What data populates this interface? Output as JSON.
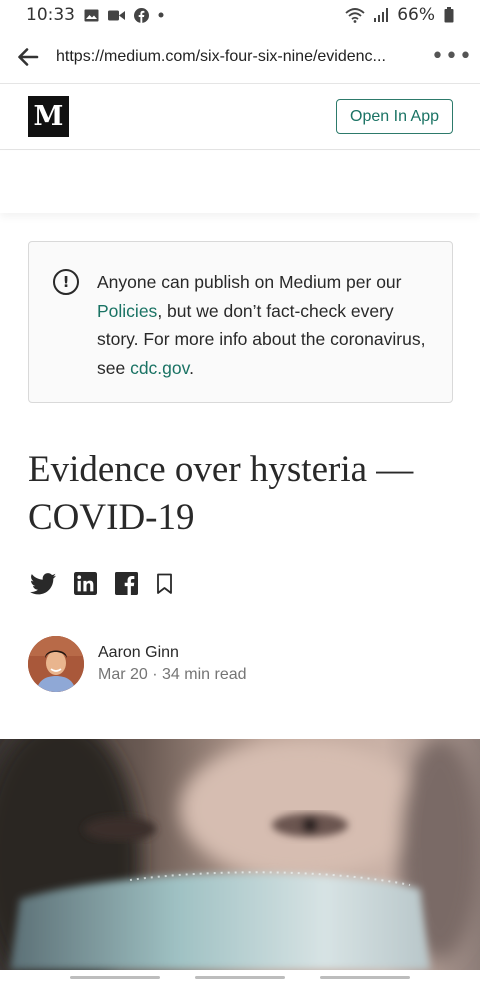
{
  "status_bar": {
    "time": "10:33",
    "battery_percent": "66%",
    "left_icons": [
      "gallery-icon",
      "video-call-icon",
      "facebook-notification-icon",
      "dot-icon"
    ],
    "right_icons": [
      "wifi-icon",
      "signal-icon",
      "battery-icon"
    ]
  },
  "browser": {
    "url": "https://medium.com/six-four-six-nine/evidenc...",
    "menu_glyph": "•••"
  },
  "header": {
    "logo_letter": "M",
    "open_app_label": "Open In App",
    "accent_color": "#1a7364"
  },
  "notice": {
    "icon_glyph": "!",
    "text_1": "Anyone can publish on Medium per our ",
    "link_policies": "Policies",
    "text_2": ", but we don’t fact-check every story. For more info about the coronavirus, see ",
    "link_cdc": "cdc.gov",
    "text_3": "."
  },
  "article": {
    "title": "Evidence over hysteria — COVID-19",
    "share_icons": [
      "twitter-icon",
      "linkedin-icon",
      "facebook-icon",
      "bookmark-icon"
    ],
    "author_name": "Aaron Ginn",
    "date_readtime": "Mar 20 · 34 min read"
  }
}
